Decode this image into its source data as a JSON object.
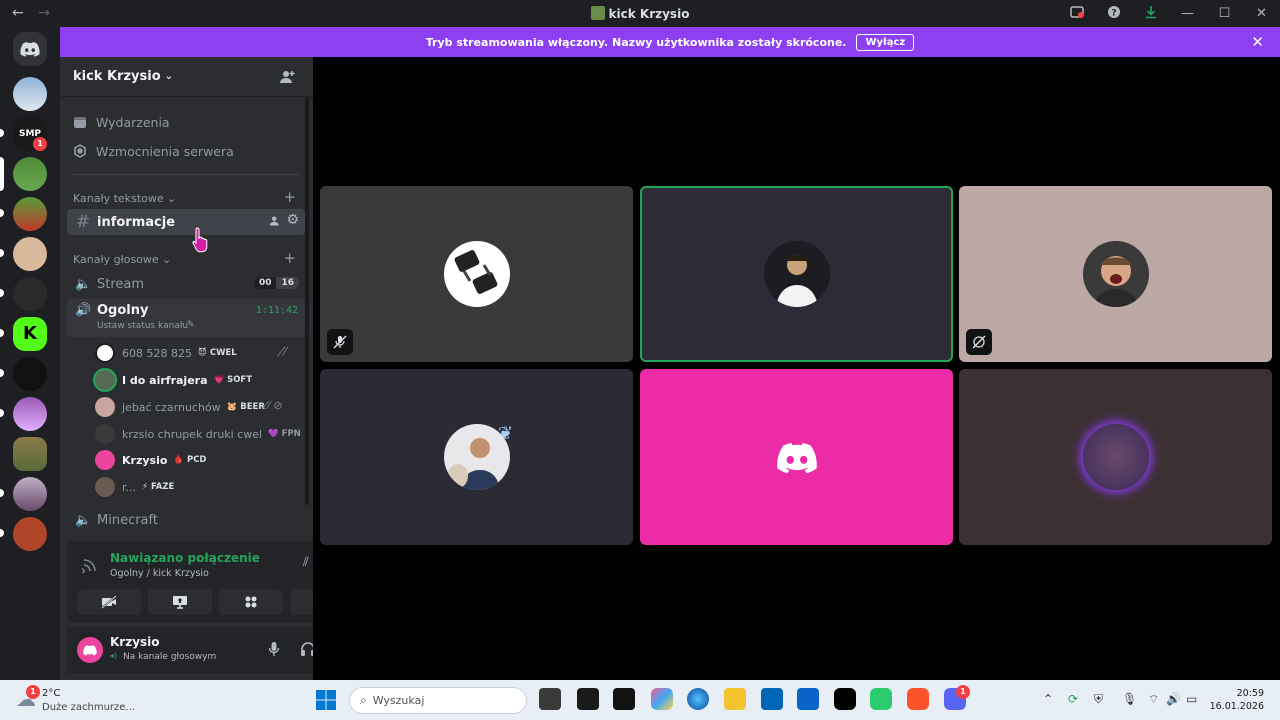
{
  "window": {
    "title": "kick Krzysio",
    "back": "←",
    "forward": "→"
  },
  "banner": {
    "message": "Tryb streamowania włączony. Nazwy użytkownika zostały skrócone.",
    "button": "Wyłącz",
    "close": "✕"
  },
  "server_list": {
    "badges": {
      "server2": "1"
    }
  },
  "server": {
    "name": "kick Krzysio",
    "menu": {
      "events": "Wydarzenia",
      "boosts": "Wzmocnienia serwera"
    },
    "text_category": "Kanały tekstowe",
    "text_channels": [
      {
        "name": "informacje"
      }
    ],
    "voice_category": "Kanały głosowe",
    "voice_channels": [
      {
        "name": "Stream",
        "count_a": "00",
        "count_b": "16"
      },
      {
        "name": "Ogolny",
        "timer": "1:11:42",
        "status": "Ustaw status kanału"
      },
      {
        "name": "Minecraft"
      }
    ],
    "voice_users": [
      {
        "name": "608 528 825",
        "tag": "CWEL",
        "tag_icon": "😈"
      },
      {
        "name": "I do airfrajera",
        "tag": "SOFT",
        "tag_icon": "💗"
      },
      {
        "name": "jebać czarnuchów",
        "tag": "BEER",
        "tag_icon": "🐹"
      },
      {
        "name": "krzsio chrupek druki cwel",
        "tag": "FPN",
        "tag_icon": "💜"
      },
      {
        "name": "Krzysio",
        "tag": "PCD",
        "tag_icon": "🩸"
      },
      {
        "name": "r...",
        "tag": "FAZE",
        "tag_icon": "⚡"
      }
    ]
  },
  "voice_status": {
    "title": "Nawiązano połączenie",
    "subtitle": "Ogolny / kick Krzysio"
  },
  "user": {
    "name": "Krzysio",
    "status": "Na kanale głosowym"
  },
  "taskbar": {
    "temp": "2°C",
    "weather": "Duże zachmurze...",
    "weather_badge": "1",
    "search_placeholder": "Wyszukaj",
    "time": "20:59",
    "date": "16.01.2026",
    "discord_badge": "1"
  },
  "colors": {
    "accent": "#8c40ef",
    "connected": "#23a55a",
    "discord_pink": "#eb459e"
  }
}
